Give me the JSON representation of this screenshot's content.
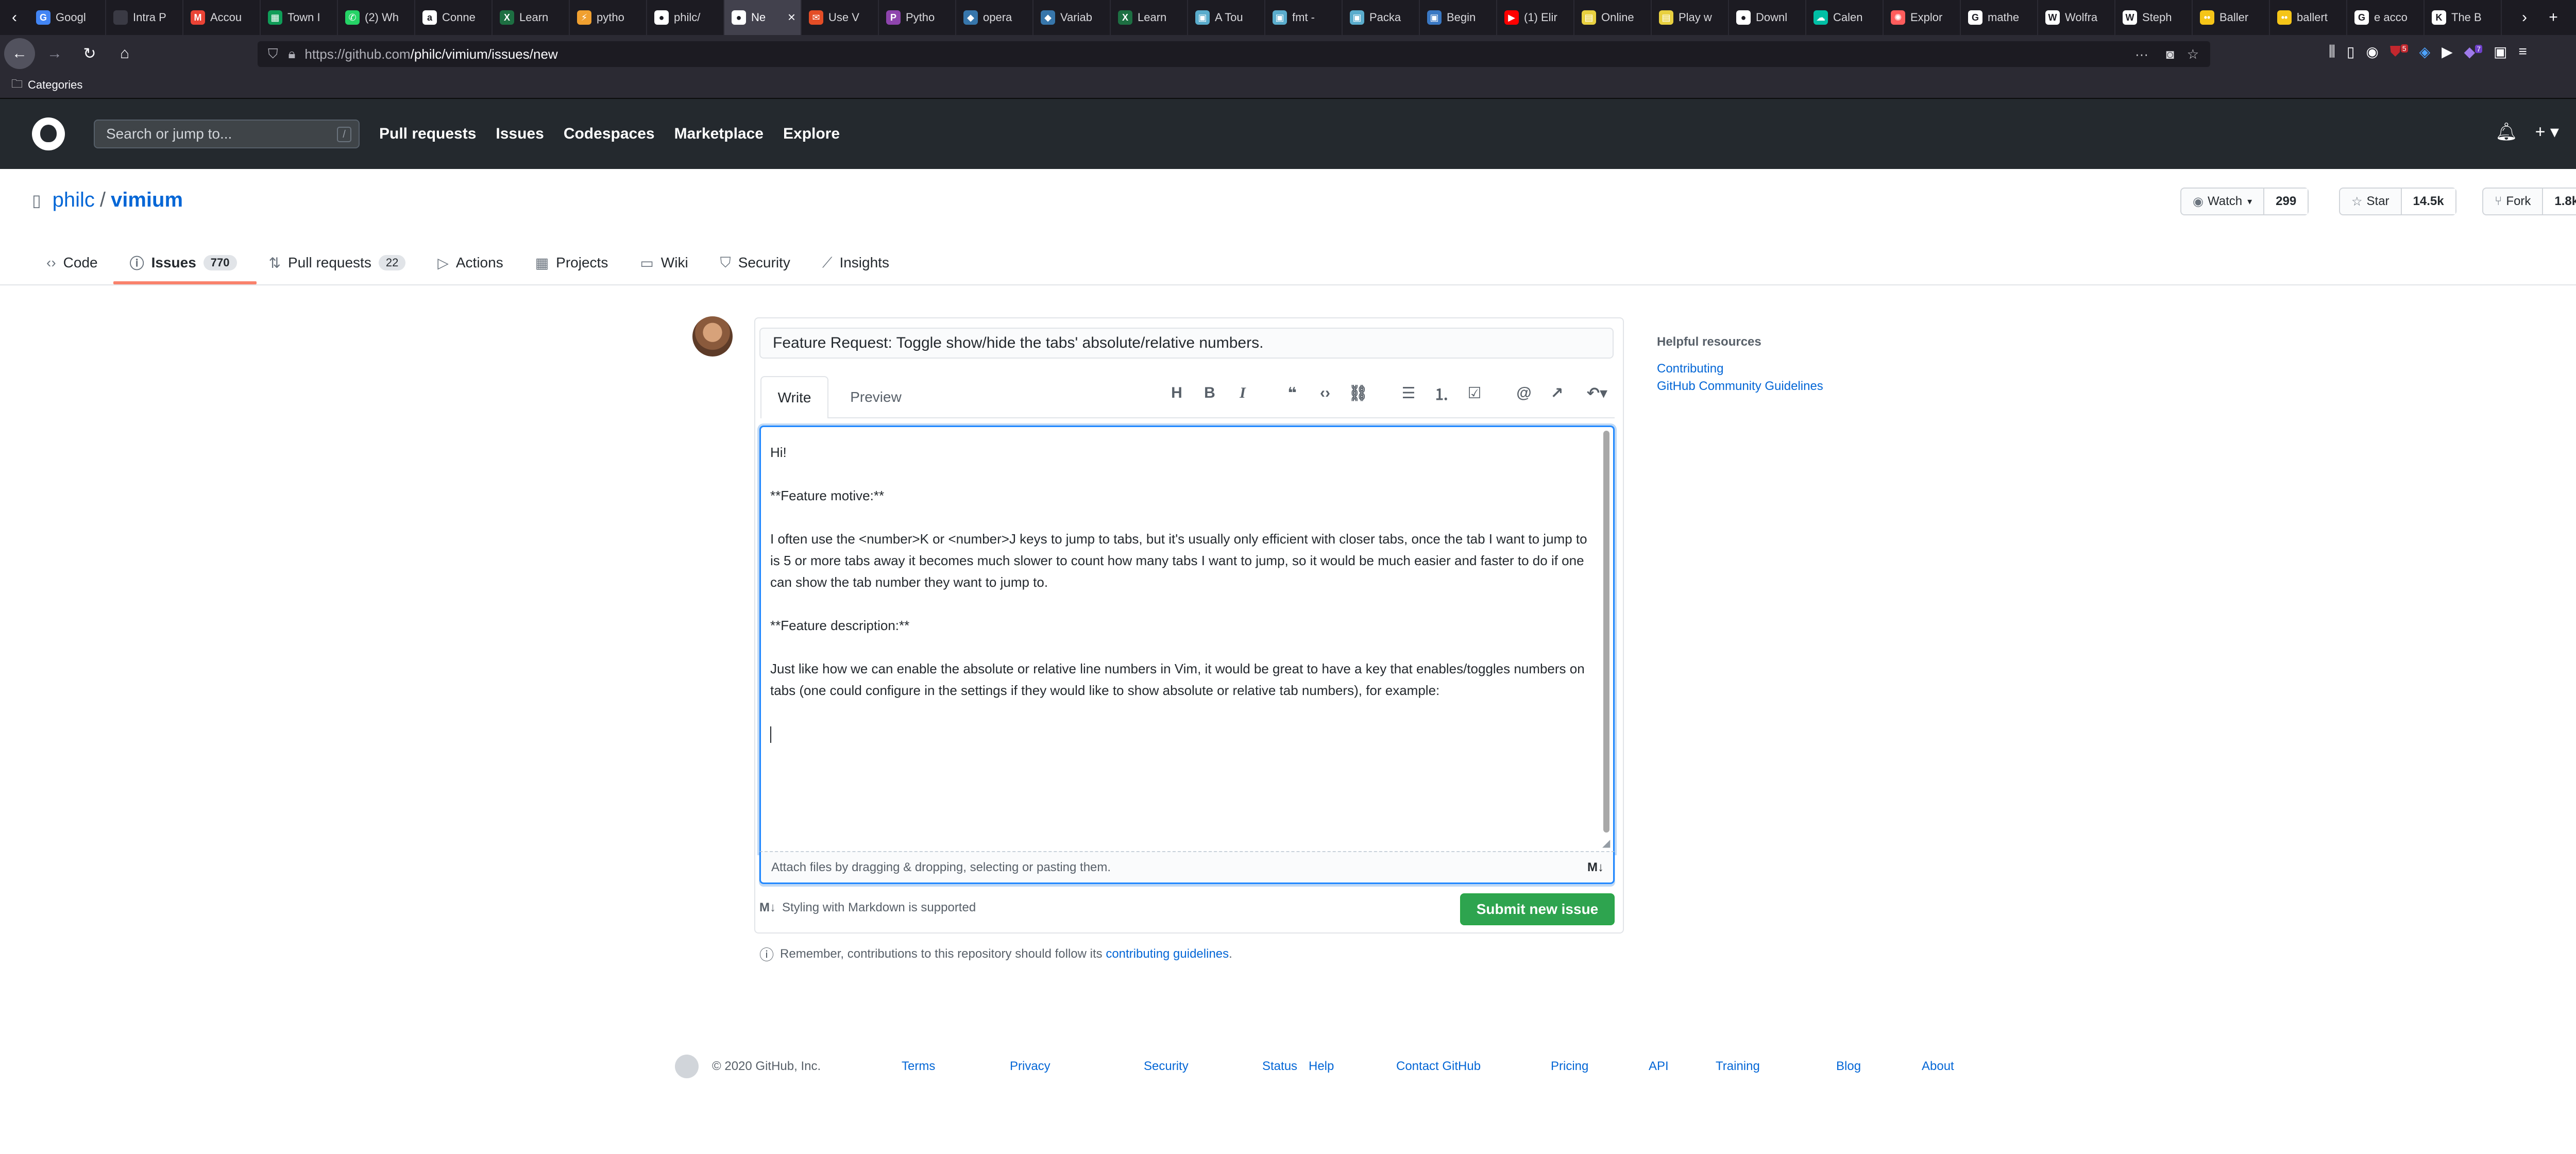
{
  "browser": {
    "tabs": [
      {
        "label": "Googl",
        "color": "#4285f4",
        "glyph": "G"
      },
      {
        "label": "Intra P",
        "color": "#3a3a44",
        "glyph": ""
      },
      {
        "label": "Accou",
        "color": "#ea4335",
        "glyph": "M"
      },
      {
        "label": "Town I",
        "color": "#0f9d58",
        "glyph": "▦"
      },
      {
        "label": "(2) Wh",
        "color": "#25d366",
        "glyph": "✆"
      },
      {
        "label": "Conne",
        "color": "#ffffff",
        "glyph": "a"
      },
      {
        "label": "Learn",
        "color": "#1d6f42",
        "glyph": "X"
      },
      {
        "label": "pytho",
        "color": "#f0a030",
        "glyph": "⚡"
      },
      {
        "label": "philc/",
        "color": "#ffffff",
        "glyph": "●"
      },
      {
        "label": "Ne",
        "color": "#ffffff",
        "glyph": "●",
        "active": true
      },
      {
        "label": "Use V",
        "color": "#e44d26",
        "glyph": "✉"
      },
      {
        "label": "Pytho",
        "color": "#8e44ad",
        "glyph": "P"
      },
      {
        "label": "opera",
        "color": "#3776ab",
        "glyph": "◆"
      },
      {
        "label": "Variab",
        "color": "#3776ab",
        "glyph": "◆"
      },
      {
        "label": "Learn",
        "color": "#1d6f42",
        "glyph": "X"
      },
      {
        "label": "A Tou",
        "color": "#5aaccc",
        "glyph": "▣"
      },
      {
        "label": "fmt - ",
        "color": "#5aaccc",
        "glyph": "▣"
      },
      {
        "label": "Packa",
        "color": "#5aaccc",
        "glyph": "▣"
      },
      {
        "label": "Begin",
        "color": "#3a78c3",
        "glyph": "▣"
      },
      {
        "label": "(1) Elir",
        "color": "#ff0000",
        "glyph": "▶"
      },
      {
        "label": "Online",
        "color": "#e8d040",
        "glyph": "▤"
      },
      {
        "label": "Play w",
        "color": "#e8d040",
        "glyph": "▤"
      },
      {
        "label": "Downl",
        "color": "#ffffff",
        "glyph": "●"
      },
      {
        "label": "Calen",
        "color": "#00bfa5",
        "glyph": "☁"
      },
      {
        "label": "Explor",
        "color": "#ff5c5c",
        "glyph": "✺"
      },
      {
        "label": "mathe",
        "color": "#ffffff",
        "glyph": "G"
      },
      {
        "label": "Wolfra",
        "color": "#ffffff",
        "glyph": "W"
      },
      {
        "label": "Steph",
        "color": "#ffffff",
        "glyph": "W"
      },
      {
        "label": "Baller",
        "color": "#f5c518",
        "glyph": "••"
      },
      {
        "label": "ballert",
        "color": "#f5c518",
        "glyph": "••"
      },
      {
        "label": "e acco",
        "color": "#ffffff",
        "glyph": "G"
      },
      {
        "label": "The B",
        "color": "#ffffff",
        "glyph": "K"
      }
    ],
    "url_host": "https://github.com",
    "url_path": "/philc/vimium/issues/new",
    "bookmark_folder": "Categories",
    "ext_badges": [
      "5",
      "7"
    ]
  },
  "gh_header": {
    "search_placeholder": "Search or jump to...",
    "search_key": "/",
    "nav": [
      "Pull requests",
      "Issues",
      "Codespaces",
      "Marketplace",
      "Explore"
    ]
  },
  "repo": {
    "owner": "philc",
    "sep": "/",
    "name": "vimium",
    "watch_label": "Watch",
    "watch_count": "299",
    "star_label": "Star",
    "star_count": "14.5k",
    "fork_label": "Fork",
    "fork_count": "1.8k"
  },
  "repo_tabs": [
    {
      "label": "Code",
      "icon": "‹›"
    },
    {
      "label": "Issues",
      "icon": "ⓘ",
      "count": "770",
      "selected": true
    },
    {
      "label": "Pull requests",
      "icon": "⇅",
      "count": "22"
    },
    {
      "label": "Actions",
      "icon": "▷"
    },
    {
      "label": "Projects",
      "icon": "▦"
    },
    {
      "label": "Wiki",
      "icon": "▭"
    },
    {
      "label": "Security",
      "icon": "⛉"
    },
    {
      "label": "Insights",
      "icon": "⟋"
    }
  ],
  "issue_form": {
    "title_value": "Feature Request: Toggle show/hide the tabs' absolute/relative numbers.",
    "write_tab": "Write",
    "preview_tab": "Preview",
    "body_paragraphs": [
      "Hi!",
      "**Feature motive:**",
      "I often use the <number>K or <number>J keys to jump to tabs, but it's usually only efficient with closer tabs, once the tab I want to jump to is 5 or more tabs away it becomes much slower to count how many tabs I want to jump, so it would be much easier and faster to do if one can show the tab number they want to jump to.",
      "**Feature description:**",
      "Just like how we can enable the absolute or relative line numbers in Vim, it would be great to have a key that enables/toggles numbers on tabs (one could configure in the settings if they would like to show absolute or relative tab numbers), for example:"
    ],
    "attach_text": "Attach files by dragging & dropping, selecting or pasting them.",
    "markdown_note": "Styling with Markdown is supported",
    "submit_label": "Submit new issue",
    "contrib_prefix": "Remember, contributions to this repository should follow its",
    "contrib_link": "contributing guidelines",
    "contrib_suffix": "."
  },
  "sidebar": {
    "heading": "Helpful resources",
    "links": [
      "Contributing",
      "GitHub Community Guidelines"
    ]
  },
  "footer": {
    "copyright": "© 2020 GitHub, Inc.",
    "links": [
      "Terms",
      "Privacy",
      "Security",
      "Status",
      "Help",
      "Contact GitHub",
      "Pricing",
      "API",
      "Training",
      "Blog",
      "About"
    ]
  },
  "colors": {
    "accent_blue": "#0366d6",
    "submit_green": "#2ea44f",
    "selected_tab_underline": "#f9826c",
    "header_dark": "#24292e"
  }
}
